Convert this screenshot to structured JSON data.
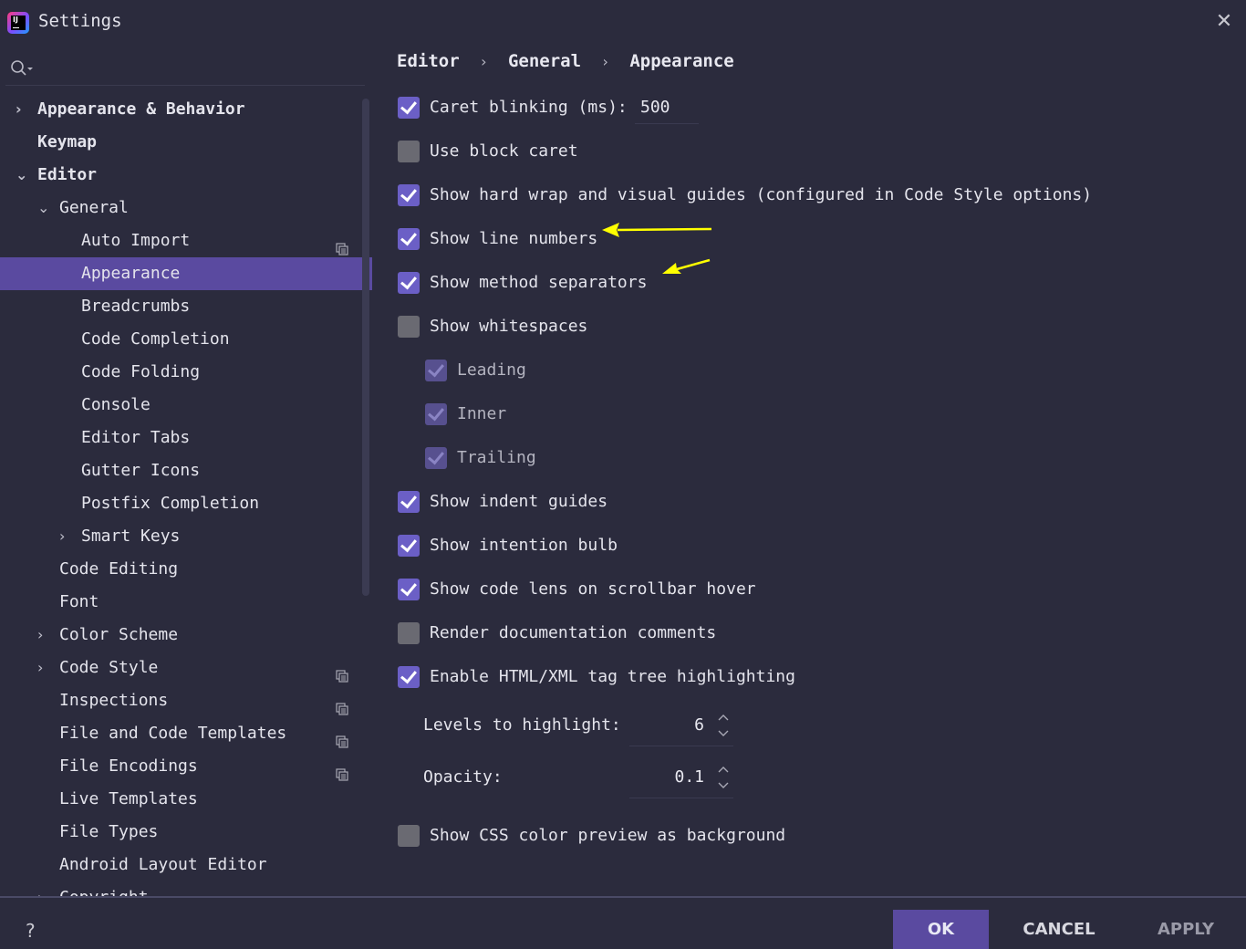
{
  "window": {
    "title": "Settings",
    "close_glyph": "✕"
  },
  "search": {
    "icon": "search-icon"
  },
  "sidebar": {
    "items": [
      {
        "label": "Appearance & Behavior",
        "level": 0,
        "arrow": "›",
        "bold": true
      },
      {
        "label": "Keymap",
        "level": 0,
        "arrow": "",
        "bold": true
      },
      {
        "label": "Editor",
        "level": 0,
        "arrow": "⌄",
        "bold": true
      },
      {
        "label": "General",
        "level": 1,
        "arrow": "⌄"
      },
      {
        "label": "Auto Import",
        "level": 2,
        "project_icon": true
      },
      {
        "label": "Appearance",
        "level": 2,
        "selected": true
      },
      {
        "label": "Breadcrumbs",
        "level": 2
      },
      {
        "label": "Code Completion",
        "level": 2
      },
      {
        "label": "Code Folding",
        "level": 2
      },
      {
        "label": "Console",
        "level": 2
      },
      {
        "label": "Editor Tabs",
        "level": 2
      },
      {
        "label": "Gutter Icons",
        "level": 2
      },
      {
        "label": "Postfix Completion",
        "level": 2
      },
      {
        "label": "Smart Keys",
        "level": 2,
        "arrow": "›"
      },
      {
        "label": "Code Editing",
        "level": 1
      },
      {
        "label": "Font",
        "level": 1
      },
      {
        "label": "Color Scheme",
        "level": 1,
        "arrow": "›"
      },
      {
        "label": "Code Style",
        "level": 1,
        "arrow": "›",
        "project_icon": true
      },
      {
        "label": "Inspections",
        "level": 1,
        "project_icon": true
      },
      {
        "label": "File and Code Templates",
        "level": 1,
        "project_icon": true
      },
      {
        "label": "File Encodings",
        "level": 1,
        "project_icon": true
      },
      {
        "label": "Live Templates",
        "level": 1
      },
      {
        "label": "File Types",
        "level": 1
      },
      {
        "label": "Android Layout Editor",
        "level": 1
      },
      {
        "label": "Copyright",
        "level": 1,
        "arrow": "›",
        "project_icon": true
      }
    ]
  },
  "breadcrumb": {
    "part1": "Editor",
    "part2": "General",
    "part3": "Appearance",
    "sep": "›"
  },
  "options": {
    "caret_blinking": {
      "label": "Caret blinking (ms):",
      "checked": true,
      "value": "500"
    },
    "block_caret": {
      "label": "Use block caret",
      "checked": false
    },
    "hard_wrap": {
      "label": "Show hard wrap and visual guides (configured in Code Style options)",
      "checked": true
    },
    "line_numbers": {
      "label": "Show line numbers",
      "checked": true
    },
    "method_separators": {
      "label": "Show method separators",
      "checked": true
    },
    "whitespaces": {
      "label": "Show whitespaces",
      "checked": false
    },
    "leading": {
      "label": "Leading",
      "checked": true,
      "disabled": true
    },
    "inner": {
      "label": "Inner",
      "checked": true,
      "disabled": true
    },
    "trailing": {
      "label": "Trailing",
      "checked": true,
      "disabled": true
    },
    "indent_guides": {
      "label": "Show indent guides",
      "checked": true
    },
    "intention_bulb": {
      "label": "Show intention bulb",
      "checked": true
    },
    "code_lens": {
      "label": "Show code lens on scrollbar hover",
      "checked": true
    },
    "render_docs": {
      "label": "Render documentation comments",
      "checked": false
    },
    "html_xml": {
      "label": "Enable HTML/XML tag tree highlighting",
      "checked": true
    },
    "levels": {
      "label": "Levels to highlight:",
      "value": "6"
    },
    "opacity": {
      "label": "Opacity:",
      "value": "0.1"
    },
    "css_preview": {
      "label": "Show CSS color preview as background",
      "checked": false
    }
  },
  "footer": {
    "help": "?",
    "ok": "OK",
    "cancel": "CANCEL",
    "apply": "APPLY"
  },
  "colors": {
    "accent": "#5a4aa0",
    "checkbox_on": "#6b5fc6",
    "background": "#2b2b3d",
    "annotation": "#ffff00"
  }
}
